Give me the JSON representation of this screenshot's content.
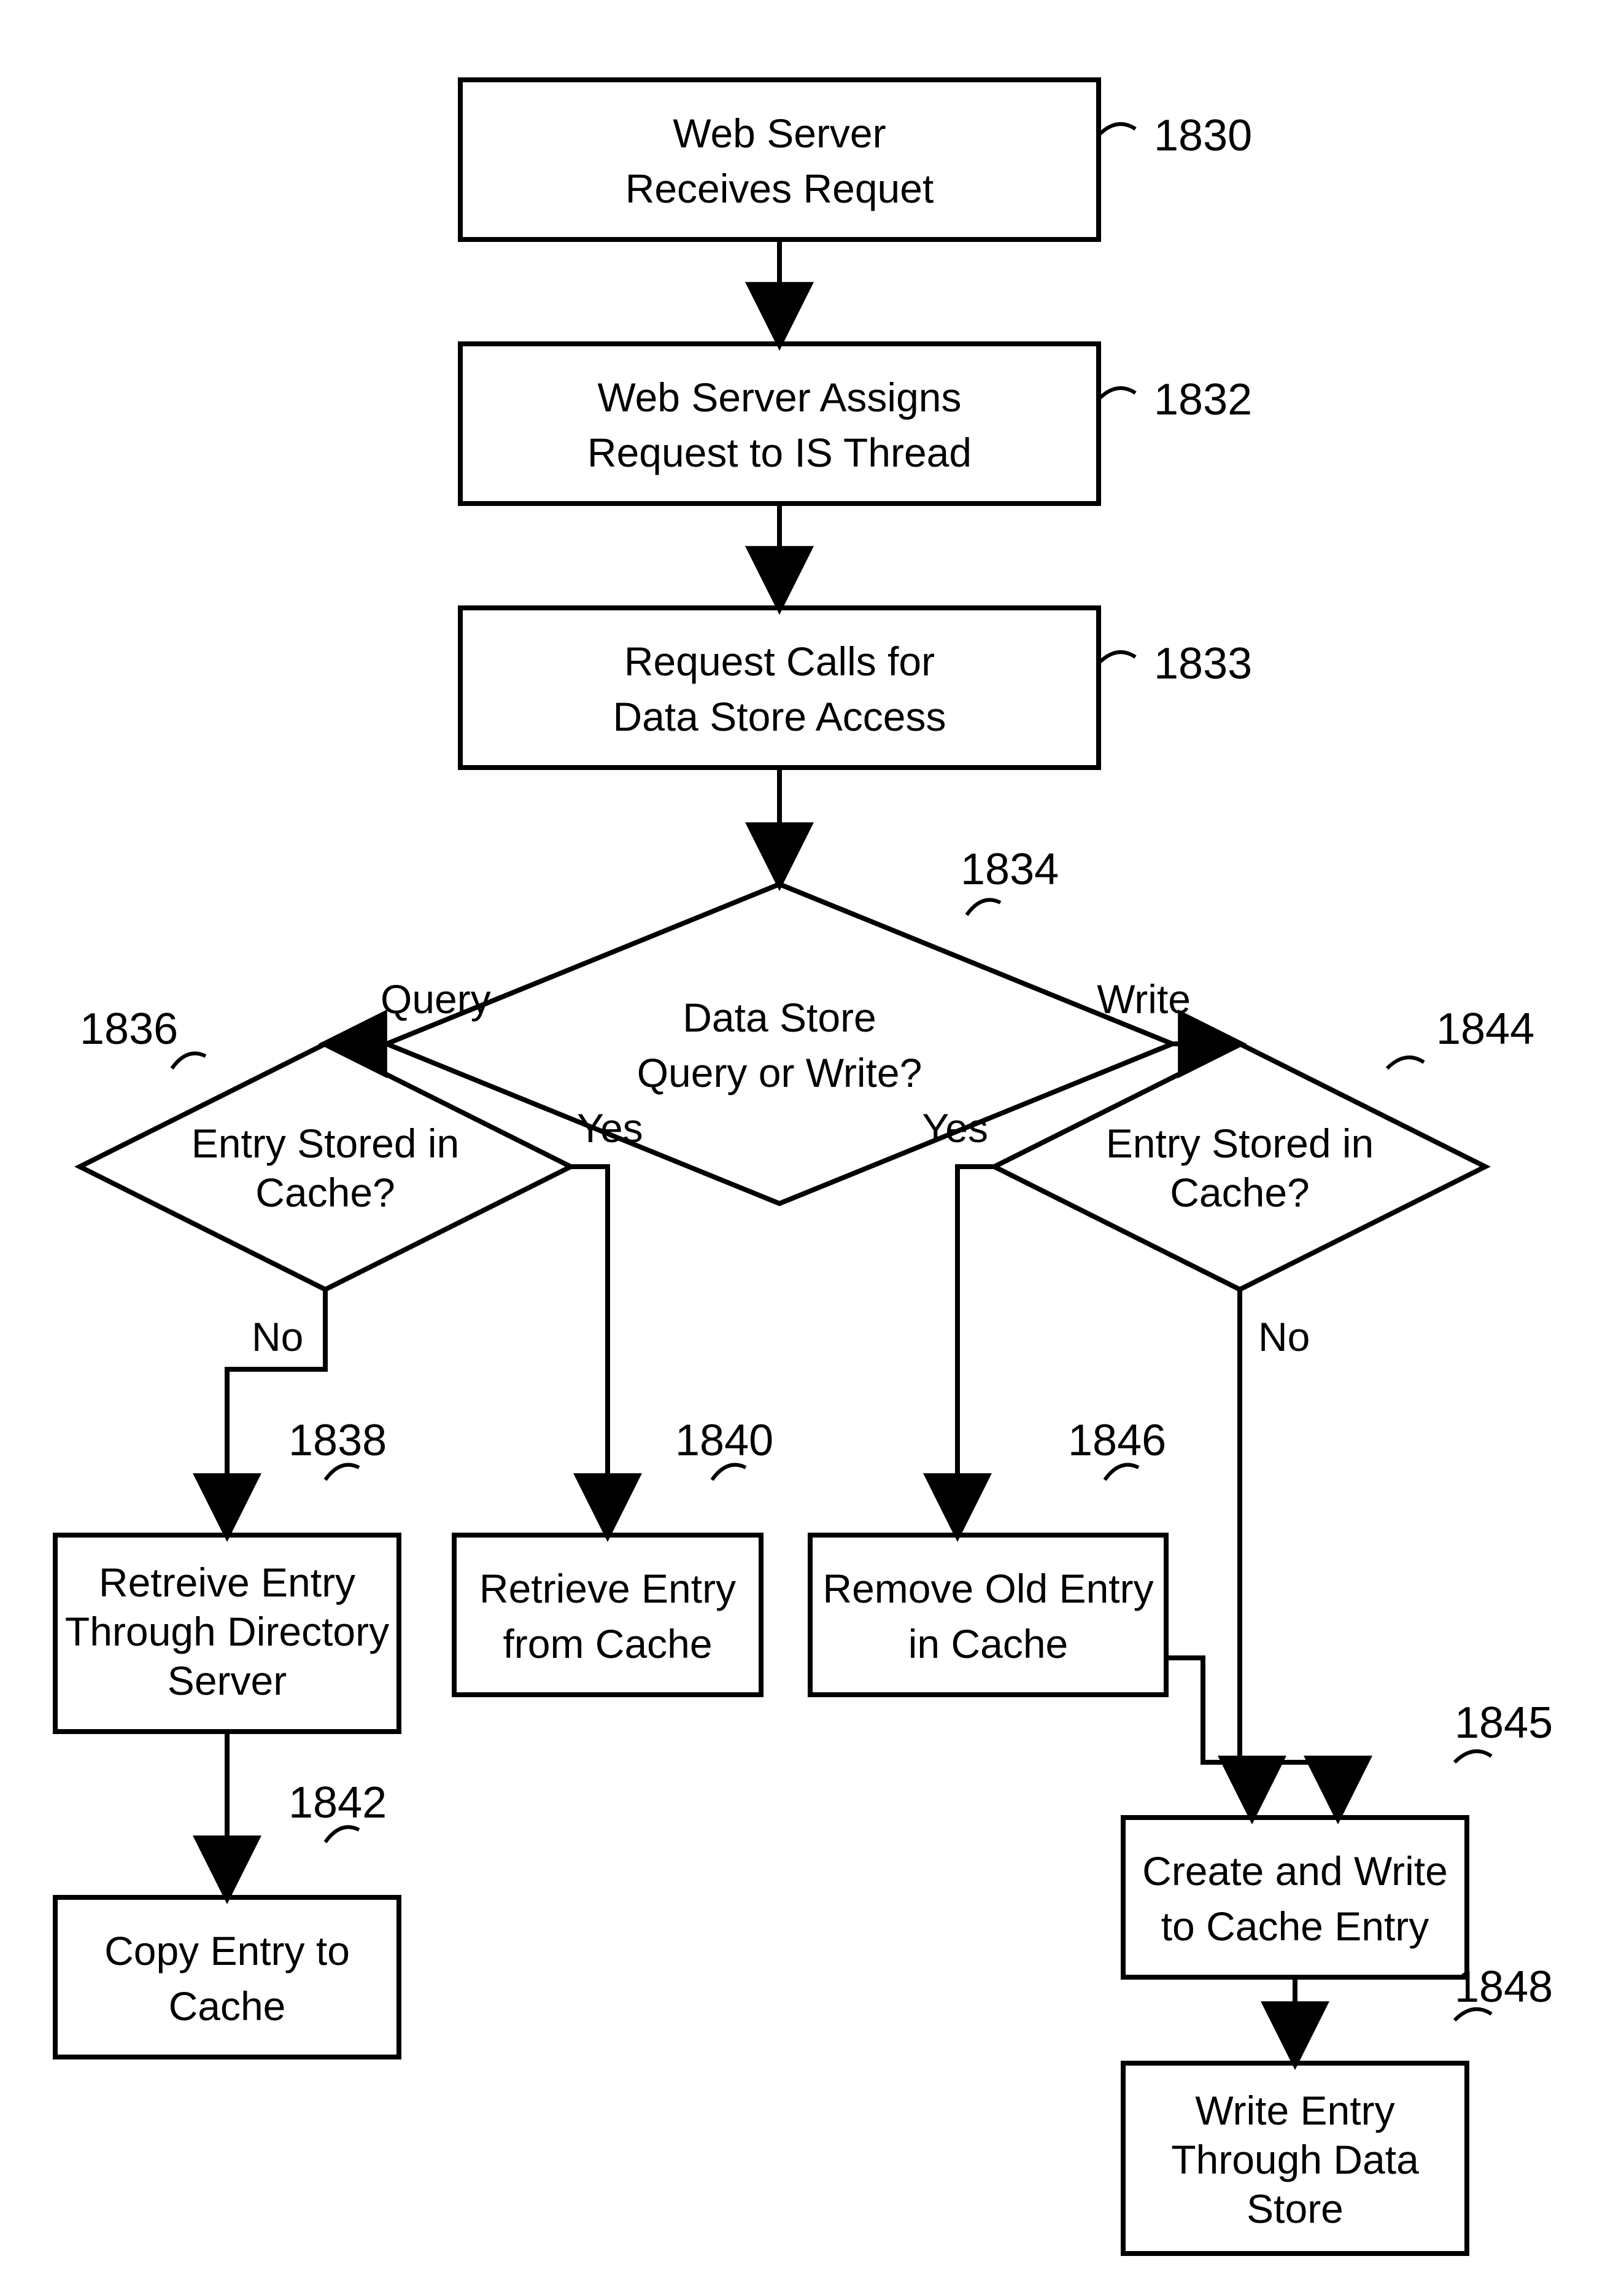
{
  "nodes": {
    "n1830": {
      "ref": "1830",
      "line1": "Web Server",
      "line2": "Receives Requet",
      "line3": ""
    },
    "n1832": {
      "ref": "1832",
      "line1": "Web Server Assigns",
      "line2": "Request to IS Thread",
      "line3": ""
    },
    "n1833": {
      "ref": "1833",
      "line1": "Request Calls for",
      "line2": "Data Store Access",
      "line3": ""
    },
    "n1834": {
      "ref": "1834",
      "line1": "Data Store",
      "line2": "Query or Write?",
      "line3": ""
    },
    "n1836": {
      "ref": "1836",
      "line1": "Entry Stored in",
      "line2": "Cache?",
      "line3": ""
    },
    "n1844": {
      "ref": "1844",
      "line1": "Entry Stored in",
      "line2": "Cache?",
      "line3": ""
    },
    "n1838": {
      "ref": "1838",
      "line1": "Retreive Entry",
      "line2": "Through Directory",
      "line3": "Server"
    },
    "n1840": {
      "ref": "1840",
      "line1": "Retrieve Entry",
      "line2": "from Cache",
      "line3": ""
    },
    "n1846": {
      "ref": "1846",
      "line1": "Remove Old Entry",
      "line2": "in Cache",
      "line3": ""
    },
    "n1842": {
      "ref": "1842",
      "line1": "Copy Entry to",
      "line2": "Cache",
      "line3": ""
    },
    "n1845": {
      "ref": "1845",
      "line1": "Create and Write",
      "line2": "to Cache Entry",
      "line3": ""
    },
    "n1848": {
      "ref": "1848",
      "line1": "Write Entry",
      "line2": "Through Data",
      "line3": "Store"
    }
  },
  "edge_labels": {
    "query": "Query",
    "write": "Write",
    "yes1": "Yes",
    "no1": "No",
    "yes2": "Yes",
    "no2": "No"
  }
}
